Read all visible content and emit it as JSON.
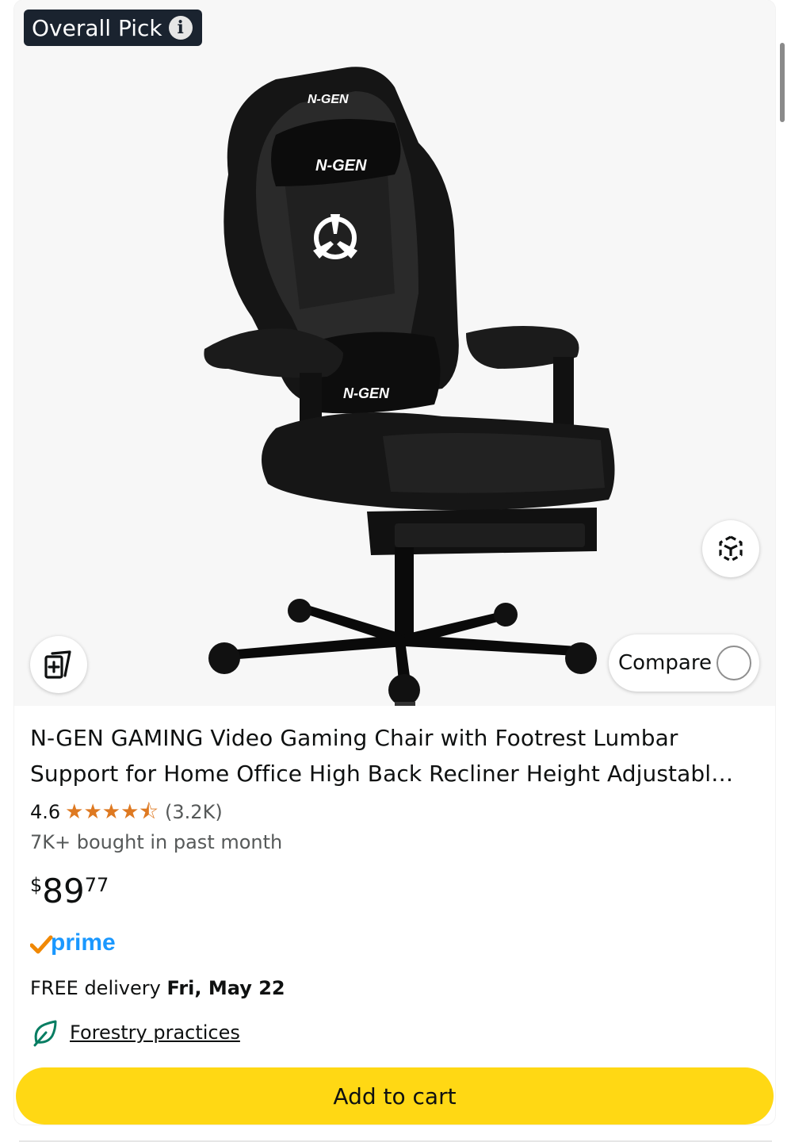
{
  "badge": {
    "label": "Overall Pick",
    "info_icon": "info-icon"
  },
  "product": {
    "image_alt": "N-GEN gaming chair with footrest",
    "brand_marks": [
      "N-GEN",
      "N-GEN",
      "N-GEN"
    ],
    "title": "N-GEN GAMING Video Gaming Chair with Footrest Lumbar Support for Home Office High Back Recliner Height Adjustabl…",
    "rating": "4.6",
    "rating_stars": 4.6,
    "rating_count": "(3.2K)",
    "bought": "7K+ bought in past month",
    "price": {
      "symbol": "$",
      "whole": "89",
      "fraction": "77"
    },
    "prime_label": "prime",
    "delivery": {
      "prefix": "FREE delivery ",
      "date": "Fri, May 22"
    },
    "climate_link": "Forestry practices"
  },
  "actions": {
    "compare_label": "Compare",
    "add_to_cart": "Add to cart",
    "view_3d_icon": "view-in-3d-icon",
    "add_to_list_icon": "add-to-list-icon"
  },
  "colors": {
    "badge_bg": "#1a232f",
    "star": "#de7921",
    "prime_blue": "#1a98ff",
    "prime_check": "#f08804",
    "cart_button": "#ffd814",
    "leaf": "#067d62"
  }
}
